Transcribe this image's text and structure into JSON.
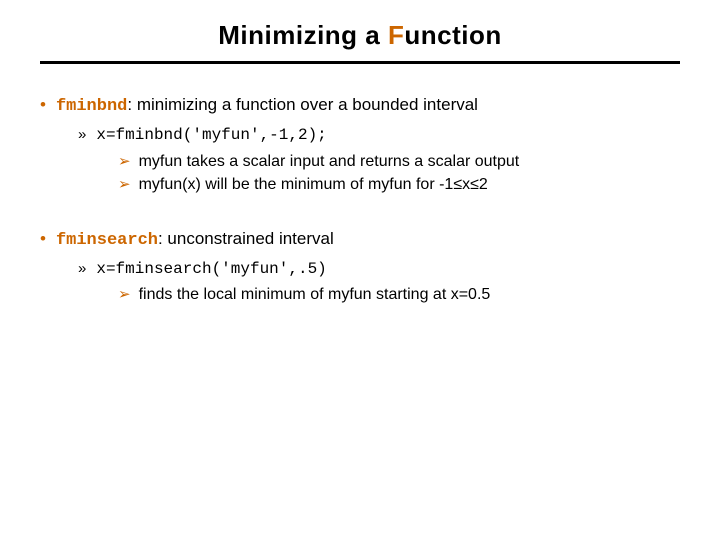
{
  "title_pre": "Minimizing a ",
  "title_orange": "F",
  "title_post": "unction",
  "b1": {
    "code": "fminbnd",
    "rest": ": minimizing a function over a bounded interval",
    "sub_code": "x=fminbnd('myfun',-1,2);",
    "s1": "myfun takes a scalar input and returns a scalar output",
    "s2_pre": "myfun(x) will be the minimum of myfun for -1",
    "s2_le1": "≤",
    "s2_mid": "x",
    "s2_le2": "≤",
    "s2_post": "2"
  },
  "b2": {
    "code": "fminsearch",
    "rest": ": unconstrained interval",
    "sub_code": "x=fminsearch('myfun',.5)",
    "s1": "finds the local minimum of myfun starting at x=0.5"
  }
}
